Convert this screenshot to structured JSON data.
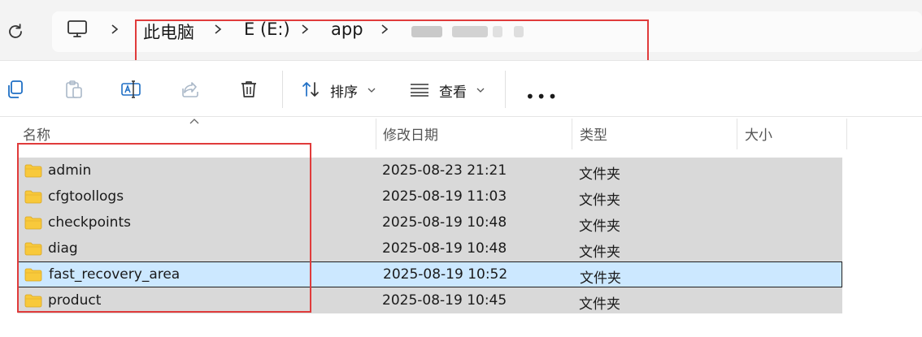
{
  "address_bar": {
    "breadcrumbs": [
      "此电脑",
      "E (E:)",
      "app"
    ],
    "last_segment": "",
    "last_segment_blurred": true
  },
  "toolbar": {
    "sort_label": "排序",
    "view_label": "查看",
    "more_label": "•••"
  },
  "columns": {
    "name": "名称",
    "modified": "修改日期",
    "type": "类型",
    "size": "大小"
  },
  "files": [
    {
      "name": "admin",
      "modified": "2025-08-23 21:21",
      "type": "文件夹",
      "selected": false
    },
    {
      "name": "cfgtoollogs",
      "modified": "2025-08-19 11:03",
      "type": "文件夹",
      "selected": false
    },
    {
      "name": "checkpoints",
      "modified": "2025-08-19 10:48",
      "type": "文件夹",
      "selected": false
    },
    {
      "name": "diag",
      "modified": "2025-08-19 10:48",
      "type": "文件夹",
      "selected": false
    },
    {
      "name": "fast_recovery_area",
      "modified": "2025-08-19 10:52",
      "type": "文件夹",
      "selected": true
    },
    {
      "name": "product",
      "modified": "2025-08-19 10:45",
      "type": "文件夹",
      "selected": false
    }
  ],
  "colors": {
    "highlight_annotation": "#e03b3b",
    "row_background": "#d9d9d9",
    "selected_row": "#cce8ff",
    "folder_yellow": "#f8c93b"
  },
  "icons": {
    "refresh": "refresh-icon",
    "this_pc": "computer-icon",
    "copy": "copy-icon",
    "paste": "paste-icon",
    "rename": "rename-icon",
    "share": "share-icon",
    "delete": "trash-icon",
    "sort": "sort-icon",
    "view": "view-icon",
    "folder": "folder-icon"
  }
}
